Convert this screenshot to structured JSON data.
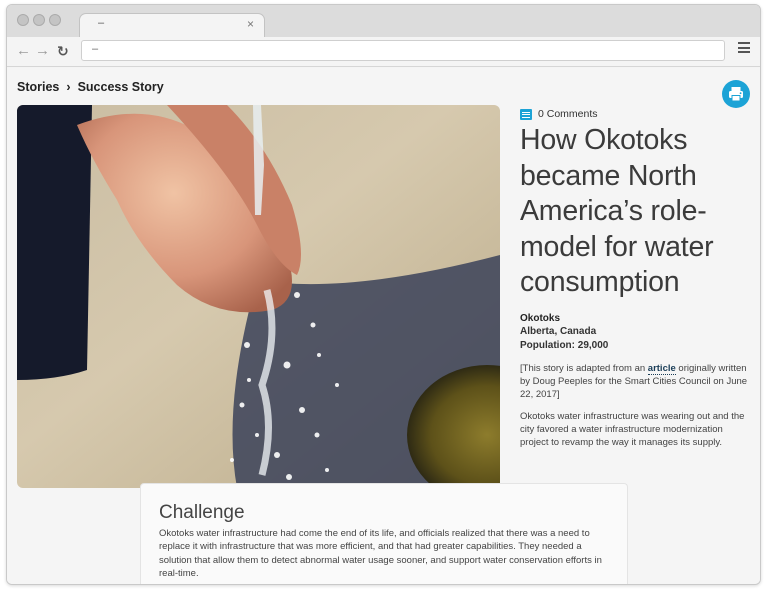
{
  "browser": {
    "tab_title": "–",
    "tab_close": "×",
    "url": "–",
    "back_glyph": "←",
    "forward_glyph": "→",
    "reload_glyph": "↻"
  },
  "breadcrumb": {
    "root": "Stories",
    "separator": "›",
    "current": "Success Story"
  },
  "article": {
    "comments": "0 Comments",
    "title": "How Okotoks became North America’s role-model for water consumption",
    "location": {
      "city": "Okotoks",
      "region": "Alberta, Canada",
      "population": "Population: 29,000"
    },
    "note_before": "[This story is adapted from an ",
    "note_link": "article",
    "note_after": " originally written by Doug Peeples for the Smart Cities Council on June 22, 2017]",
    "intro": "Okotoks water infrastructure was wearing out and the city favored a water infrastructure modernization project to revamp the way it manages its supply."
  },
  "challenge": {
    "heading": "Challenge",
    "body": "Okotoks water infrastructure had come the end of its life, and officials realized that there was a need to replace it with infrastructure that was more efficient, and that had greater capabilities. They needed a solution that allow them to detect abnormal water usage sooner, and support water conservation efforts in real-time."
  },
  "icons": {
    "print": "printer-icon",
    "comments": "comment-icon",
    "menu": "hamburger-menu-icon"
  },
  "colors": {
    "accent": "#1ca3d6",
    "link": "#1a3d57",
    "headline": "#3b3b3b"
  }
}
